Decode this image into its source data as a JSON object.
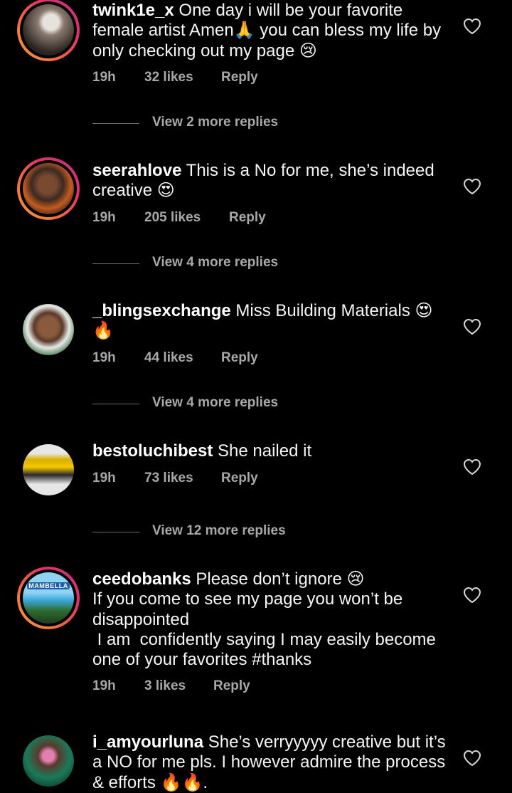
{
  "comments": [
    {
      "username": "twink1e_x",
      "text": "One day i will be your favorite female artist Amen🙏 you can bless my life by only checking out my page 😢",
      "time": "19h",
      "likes": "32 likes",
      "reply": "Reply",
      "view_replies": "View 2 more replies",
      "avatar_icon": "profile-photo-icon"
    },
    {
      "username": "seerahlove",
      "text": "This is a No for me, she’s indeed creative 😍",
      "time": "19h",
      "likes": "205 likes",
      "reply": "Reply",
      "view_replies": "View 4 more replies",
      "avatar_icon": "profile-photo-icon"
    },
    {
      "username": "_blingsexchange",
      "text": "Miss Building Materials 😍 🔥",
      "time": "19h",
      "likes": "44 likes",
      "reply": "Reply",
      "view_replies": "View 4 more replies",
      "avatar_icon": "profile-photo-icon"
    },
    {
      "username": "bestoluchibest",
      "text": "She nailed it",
      "time": "19h",
      "likes": "73 likes",
      "reply": "Reply",
      "view_replies": "View 12 more replies",
      "avatar_icon": "profile-photo-icon"
    },
    {
      "username": "ceedobanks",
      "text_line1": "Please don’t ignore 😢",
      "text_line2": "If you come to see my page you won’t be disappointed",
      "text_line3": " I am  confidently saying I may easily become one of your favorites #thanks",
      "time": "19h",
      "likes": "3 likes",
      "reply": "Reply",
      "avatar_badge": "MAMBELLA",
      "avatar_icon": "profile-photo-icon"
    },
    {
      "username": "i_amyourluna",
      "text": "She’s verryyyyy creative but it’s a NO for me pls. I however admire the process & efforts 🔥🔥.",
      "avatar_icon": "profile-photo-icon"
    }
  ],
  "icons": {
    "like": "heart-outline-icon"
  },
  "colors": {
    "background": "#000000",
    "meta_text": "#a8a8a8",
    "story_ring": "#e1306c"
  }
}
